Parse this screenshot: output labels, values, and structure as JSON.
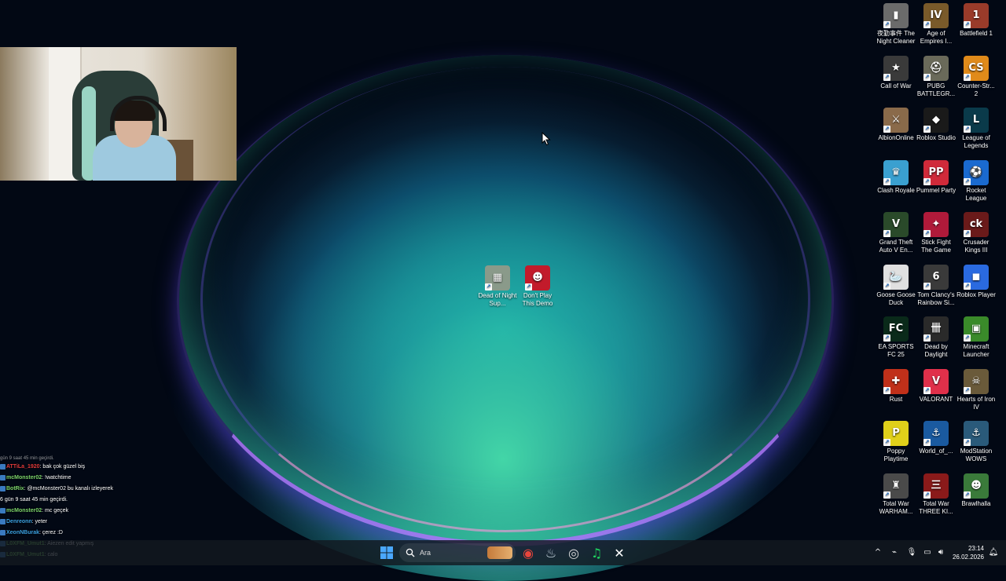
{
  "desktop": {
    "center_icons": [
      {
        "label": "Dead of Night Sup...",
        "color": "#8a9a8a",
        "glyph": "▦"
      },
      {
        "label": "Don't Play This Demo",
        "color": "#c21b2b",
        "glyph": "☻"
      }
    ],
    "right_icons": [
      {
        "label": "夜勤事件 The Night Cleaner",
        "color": "#6b6b6b",
        "glyph": "▮"
      },
      {
        "label": "Age of Empires I...",
        "color": "#7a5a2a",
        "glyph": "IV"
      },
      {
        "label": "Battlefield 1",
        "color": "#9a3b2a",
        "glyph": "1"
      },
      {
        "label": "Call of War",
        "color": "#3a3a3a",
        "glyph": "★"
      },
      {
        "label": "PUBG BATTLEGR...",
        "color": "#6a6a5a",
        "glyph": "⛑"
      },
      {
        "label": "Counter-Str... 2",
        "color": "#e08a1a",
        "glyph": "CS"
      },
      {
        "label": "AlbionOnline",
        "color": "#8a6a4a",
        "glyph": "⚔"
      },
      {
        "label": "Roblox Studio",
        "color": "#1a1a1a",
        "glyph": "◆"
      },
      {
        "label": "League of Legends",
        "color": "#0a3a4a",
        "glyph": "L"
      },
      {
        "label": "Clash Royale",
        "color": "#3aa0d0",
        "glyph": "♛"
      },
      {
        "label": "Pummel Party",
        "color": "#d02a3a",
        "glyph": "PP"
      },
      {
        "label": "Rocket League",
        "color": "#1a6ad0",
        "glyph": "⚽"
      },
      {
        "label": "Grand Theft Auto V En...",
        "color": "#2a4a2a",
        "glyph": "V"
      },
      {
        "label": "Stick Fight The Game",
        "color": "#b01a3a",
        "glyph": "✦"
      },
      {
        "label": "Crusader Kings III",
        "color": "#6a1a1a",
        "glyph": "ck"
      },
      {
        "label": "Goose Goose Duck",
        "color": "#e0e0e0",
        "glyph": "🦢"
      },
      {
        "label": "Tom Clancy's Rainbow Si...",
        "color": "#3a3a3a",
        "glyph": "6"
      },
      {
        "label": "Roblox Player",
        "color": "#2a6ae0",
        "glyph": "◼"
      },
      {
        "label": "EA SPORTS FC 25",
        "color": "#0a2a1a",
        "glyph": "FC"
      },
      {
        "label": "Dead by Daylight",
        "color": "#2a2a2a",
        "glyph": "卌"
      },
      {
        "label": "Minecraft Launcher",
        "color": "#3a8a2a",
        "glyph": "▣"
      },
      {
        "label": "Rust",
        "color": "#c0301a",
        "glyph": "✚"
      },
      {
        "label": "VALORANT",
        "color": "#e0304a",
        "glyph": "V"
      },
      {
        "label": "Hearts of Iron IV",
        "color": "#6a5a3a",
        "glyph": "☠"
      },
      {
        "label": "Poppy Playtime",
        "color": "#e0d01a",
        "glyph": "P"
      },
      {
        "label": "World_of_...",
        "color": "#1a5aa0",
        "glyph": "⚓"
      },
      {
        "label": "ModStation WOWS",
        "color": "#2a5a7a",
        "glyph": "⚓"
      },
      {
        "label": "Total War WARHAM...",
        "color": "#4a4a4a",
        "glyph": "♜"
      },
      {
        "label": "Total War THREE KI...",
        "color": "#8a1a1a",
        "glyph": "三"
      },
      {
        "label": "Brawlhalla",
        "color": "#3a7a3a",
        "glyph": "☻"
      }
    ]
  },
  "chat": {
    "partial_top": "gün 9 saat 45 min geçirdi.",
    "messages": [
      {
        "user": "ATTiLa_1920",
        "user_color": "#e03a3a",
        "text": ": bak çok güzel biş"
      },
      {
        "user": "mcMonster02",
        "user_color": "#7cd46a",
        "text": ": !watchtime"
      },
      {
        "user": "BotRix",
        "user_color": "#7cd46a",
        "text": ": @mcMonster02 bu kanalı izleyerek"
      },
      {
        "user": "",
        "user_color": "#ffffff",
        "text": "6 gün 9 saat 45 min geçirdi."
      },
      {
        "user": "mcMonster02",
        "user_color": "#7cd46a",
        "text": ": mc geçek"
      },
      {
        "user": "Denreonn",
        "user_color": "#3aa0e0",
        "text": ": yeter"
      },
      {
        "user": "XeonNBurak",
        "user_color": "#3aa0e0",
        "text": ": çerez :D"
      },
      {
        "user": "L0XFM_Umut1",
        "user_color": "#7cd46a",
        "text": ": Aiezen edit yapmış"
      },
      {
        "user": "L0XFM_Umut1",
        "user_color": "#7cd46a",
        "text": ": calo"
      }
    ]
  },
  "taskbar": {
    "search_placeholder": "Ara",
    "apps": [
      {
        "name": "start-button",
        "glyph": "⊞",
        "color": "#4aa8ff"
      },
      {
        "name": "chrome",
        "glyph": "◉",
        "color": "#e8453c"
      },
      {
        "name": "steam",
        "glyph": "♨",
        "color": "#c7d5e0"
      },
      {
        "name": "valorant-tracker",
        "glyph": "◎",
        "color": "#dddddd"
      },
      {
        "name": "spotify",
        "glyph": "♫",
        "color": "#1ed760"
      },
      {
        "name": "capcut",
        "glyph": "✕",
        "color": "#ffffff"
      }
    ],
    "tray": {
      "chevron": "^",
      "time": "23:14",
      "date": "26.02.2026"
    }
  }
}
